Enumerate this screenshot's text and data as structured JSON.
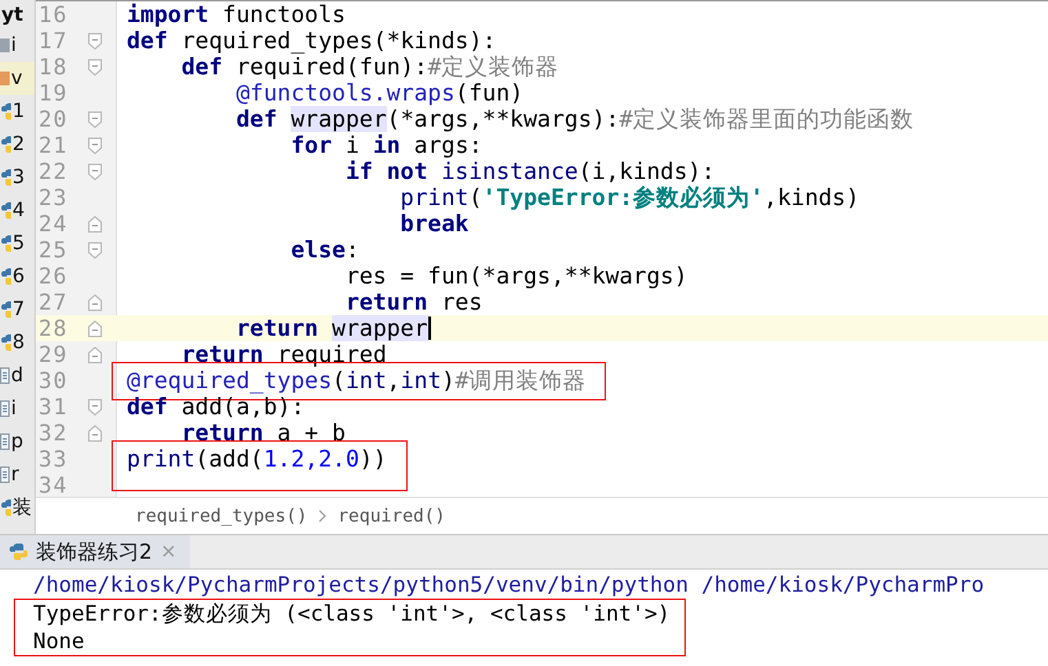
{
  "project_tree": {
    "items": [
      {
        "label": "yt",
        "kind": "header",
        "selected": false
      },
      {
        "label": "i",
        "kind": "folder",
        "selected": false
      },
      {
        "label": "v",
        "kind": "venv",
        "selected": true
      },
      {
        "label": "1",
        "kind": "python",
        "selected": false
      },
      {
        "label": "2",
        "kind": "python",
        "selected": false
      },
      {
        "label": "3",
        "kind": "python",
        "selected": false
      },
      {
        "label": "4",
        "kind": "python",
        "selected": false
      },
      {
        "label": "5",
        "kind": "python",
        "selected": false
      },
      {
        "label": "6",
        "kind": "python",
        "selected": false
      },
      {
        "label": "7",
        "kind": "python",
        "selected": false
      },
      {
        "label": "8",
        "kind": "python",
        "selected": false
      },
      {
        "label": "d",
        "kind": "file",
        "selected": false
      },
      {
        "label": "i",
        "kind": "file",
        "selected": false
      },
      {
        "label": "p",
        "kind": "file",
        "selected": false
      },
      {
        "label": "r",
        "kind": "file",
        "selected": false
      },
      {
        "label": "装",
        "kind": "python",
        "selected": false
      }
    ]
  },
  "editor": {
    "lines": [
      {
        "number": "16",
        "tokens": [
          {
            "kind": "keyword",
            "text": "import"
          },
          {
            "kind": "plain",
            "text": " functools"
          }
        ]
      },
      {
        "number": "17",
        "fold_open": true,
        "tokens": [
          {
            "kind": "keyword",
            "text": "def"
          },
          {
            "kind": "plain",
            "text": " required_types(*kinds):"
          }
        ]
      },
      {
        "number": "18",
        "fold_open": true,
        "tokens": [
          {
            "kind": "keyword",
            "text": "    def"
          },
          {
            "kind": "plain",
            "text": " required(fun):"
          },
          {
            "kind": "comment",
            "text": "#定义装饰器"
          }
        ]
      },
      {
        "number": "19",
        "tokens": [
          {
            "kind": "decorator",
            "text": "        @functools.wraps"
          },
          {
            "kind": "plain",
            "text": "(fun)"
          }
        ]
      },
      {
        "number": "20",
        "fold_open": true,
        "tokens": [
          {
            "kind": "keyword",
            "text": "        def "
          },
          {
            "kind": "usage",
            "text": "wrapper"
          },
          {
            "kind": "plain",
            "text": "(*args,**kwargs):"
          },
          {
            "kind": "comment",
            "text": "#定义装饰器里面的功能函数"
          }
        ]
      },
      {
        "number": "21",
        "fold_open": true,
        "tokens": [
          {
            "kind": "keyword",
            "text": "            for"
          },
          {
            "kind": "plain",
            "text": " i "
          },
          {
            "kind": "keyword",
            "text": "in"
          },
          {
            "kind": "plain",
            "text": " args:"
          }
        ]
      },
      {
        "number": "22",
        "fold_open": true,
        "tokens": [
          {
            "kind": "keyword",
            "text": "                if not "
          },
          {
            "kind": "builtin",
            "text": "isinstance"
          },
          {
            "kind": "plain",
            "text": "(i,kinds):"
          }
        ]
      },
      {
        "number": "23",
        "tokens": [
          {
            "kind": "builtin",
            "text": "                    print"
          },
          {
            "kind": "plain",
            "text": "("
          },
          {
            "kind": "string",
            "text": "'TypeError:参数必须为'"
          },
          {
            "kind": "plain",
            "text": ",kinds)"
          }
        ]
      },
      {
        "number": "24",
        "fold_close": true,
        "tokens": [
          {
            "kind": "keyword",
            "text": "                    break"
          }
        ]
      },
      {
        "number": "25",
        "fold_open": true,
        "tokens": [
          {
            "kind": "keyword",
            "text": "            else"
          },
          {
            "kind": "plain",
            "text": ":"
          }
        ]
      },
      {
        "number": "26",
        "tokens": [
          {
            "kind": "plain",
            "text": "                res = fun(*args,**kwargs)"
          }
        ]
      },
      {
        "number": "27",
        "fold_close": true,
        "tokens": [
          {
            "kind": "keyword",
            "text": "                return"
          },
          {
            "kind": "plain",
            "text": " res"
          }
        ]
      },
      {
        "number": "28",
        "fold_close": true,
        "current": true,
        "tokens": [
          {
            "kind": "keyword",
            "text": "        return "
          },
          {
            "kind": "usage",
            "text": "wrapper"
          }
        ]
      },
      {
        "number": "29",
        "fold_close": true,
        "tokens": [
          {
            "kind": "keyword",
            "text": "    return"
          },
          {
            "kind": "plain",
            "text": " required"
          }
        ]
      },
      {
        "number": "30",
        "annotated": true,
        "tokens": [
          {
            "kind": "decorator",
            "text": "@required_types"
          },
          {
            "kind": "plain",
            "text": "("
          },
          {
            "kind": "builtin",
            "text": "int"
          },
          {
            "kind": "plain",
            "text": ","
          },
          {
            "kind": "builtin",
            "text": "int"
          },
          {
            "kind": "plain",
            "text": ")"
          },
          {
            "kind": "comment",
            "text": "#调用装饰器"
          }
        ]
      },
      {
        "number": "31",
        "fold_open": true,
        "tokens": [
          {
            "kind": "keyword",
            "text": "def"
          },
          {
            "kind": "plain",
            "text": " add(a,b):"
          }
        ]
      },
      {
        "number": "32",
        "fold_close": true,
        "tokens": [
          {
            "kind": "keyword",
            "text": "    return"
          },
          {
            "kind": "plain",
            "text": " a + b"
          }
        ]
      },
      {
        "number": "33",
        "annotated": true,
        "tokens": [
          {
            "kind": "builtin",
            "text": "print"
          },
          {
            "kind": "plain",
            "text": "(add("
          },
          {
            "kind": "number",
            "text": "1.2,2.0"
          },
          {
            "kind": "plain",
            "text": "))"
          }
        ]
      },
      {
        "number": "34"
      }
    ],
    "breadcrumbs": [
      "required_types()",
      "required()"
    ]
  },
  "run_panel": {
    "tab": {
      "label": "装饰器练习2",
      "close": "×"
    },
    "command": "/home/kiosk/PycharmProjects/python5/venv/bin/python /home/kiosk/PycharmPro",
    "result_lines": [
      "TypeError:参数必须为 (<class 'int'>, <class 'int'>)",
      "None"
    ],
    "result_annotated": true
  }
}
